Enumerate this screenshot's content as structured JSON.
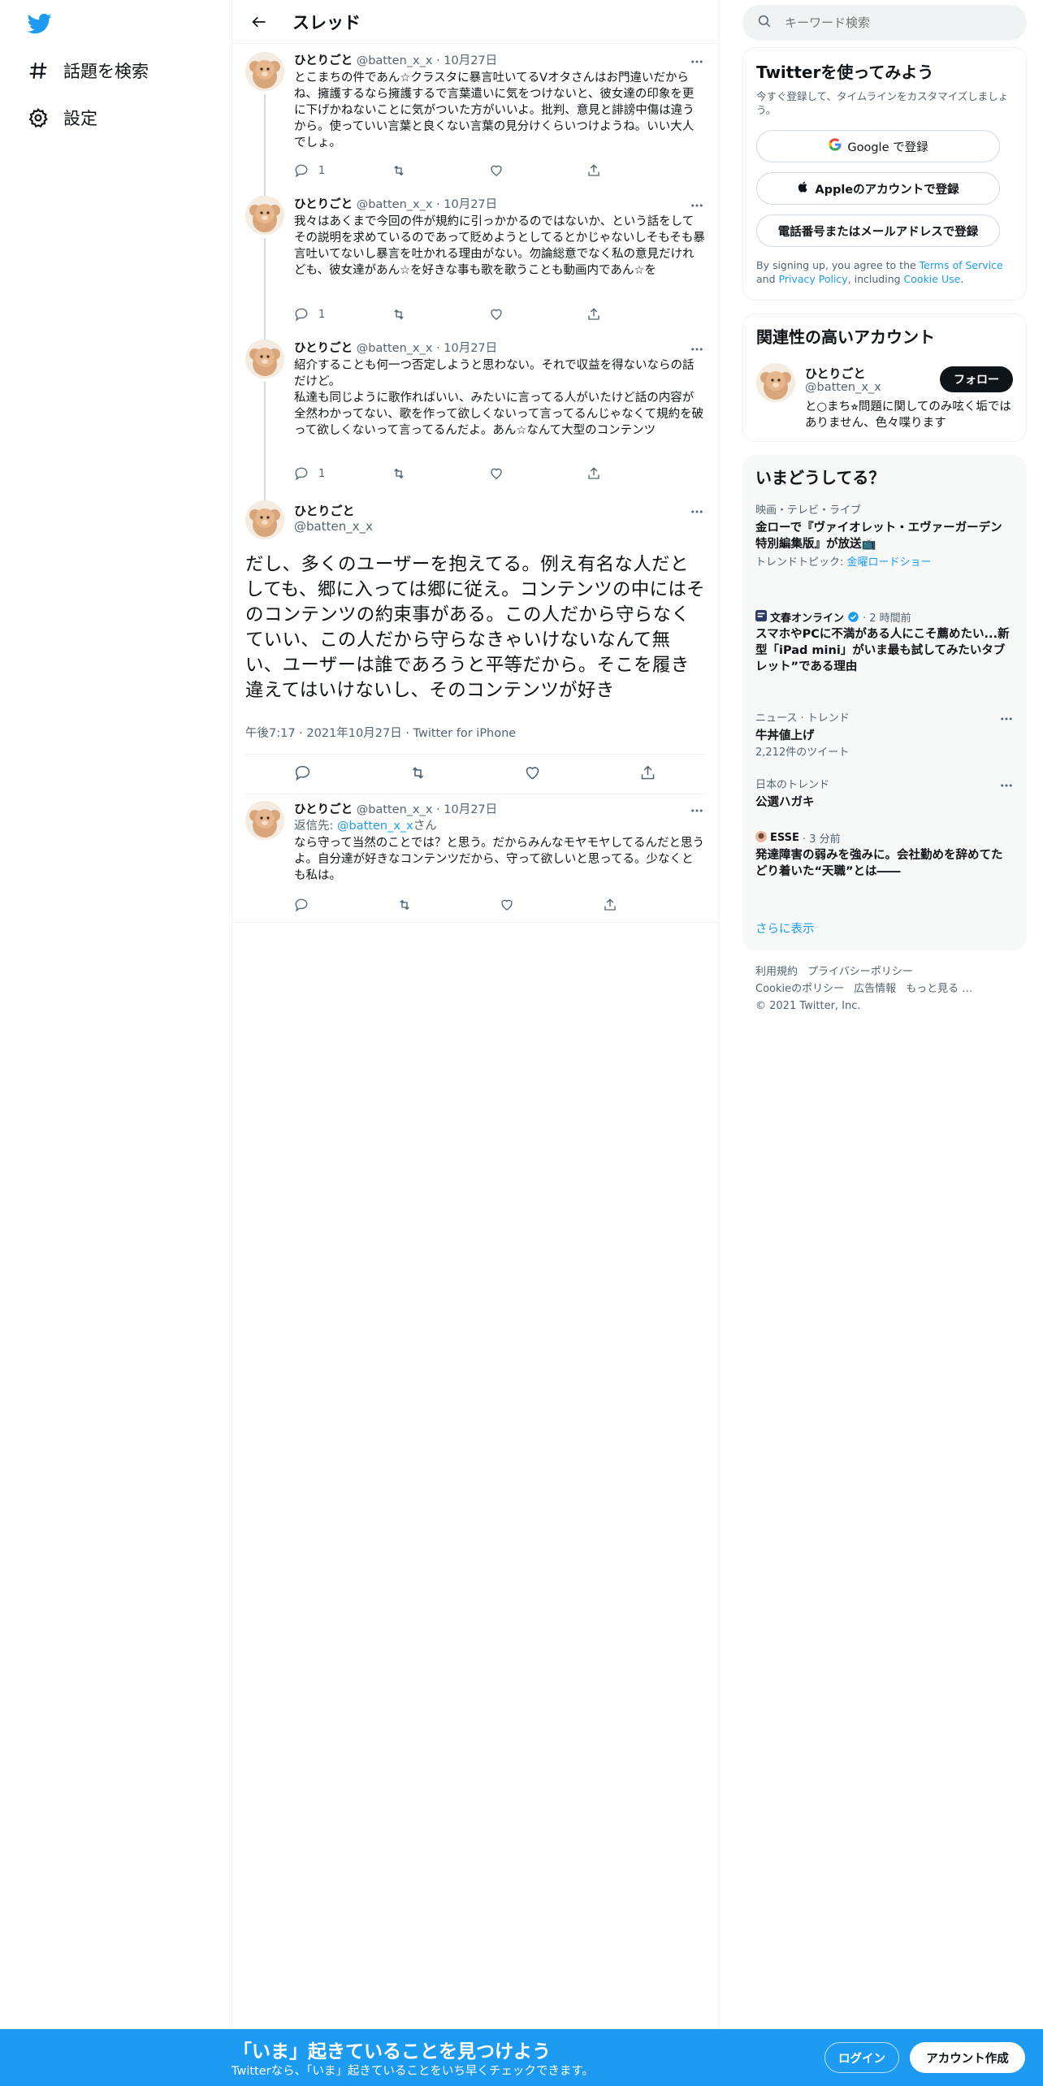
{
  "nav": {
    "explore_label": "話題を検索",
    "settings_label": "設定"
  },
  "header": {
    "title": "スレッド"
  },
  "tweets": [
    {
      "name": "ひとりごと",
      "handle": "@batten_x_x",
      "sep": "·",
      "date": "10月27日",
      "text": "とこまちの件であん☆クラスタに暴言吐いてるVオタさんはお門違いだからね、擁護するなら擁護するで言葉遣いに気をつけないと、彼女達の印象を更に下げかねないことに気がついた方がいいよ。批判、意見と誹謗中傷は違うから。使っていい言葉と良くない言葉の見分けくらいつけようね。いい大人でしょ。",
      "replies": "1"
    },
    {
      "name": "ひとりごと",
      "handle": "@batten_x_x",
      "sep": "·",
      "date": "10月27日",
      "text": "我々はあくまで今回の件が規約に引っかかるのではないか、という話をしてその説明を求めているのであって貶めようとしてるとかじゃないしそもそも暴言吐いてないし暴言を吐かれる理由がない。勿論総意でなく私の意見だけれども、彼女達があん☆を好きな事も歌を歌うことも動画内であん☆を",
      "replies": "1"
    },
    {
      "name": "ひとりごと",
      "handle": "@batten_x_x",
      "sep": "·",
      "date": "10月27日",
      "text": "紹介することも何一つ否定しようと思わない。それで収益を得ないならの話だけど。\n私達も同じように歌作ればいい、みたいに言ってる人がいたけど話の内容が全然わかってない、歌を作って欲しくないって言ってるんじゃなくて規約を破って欲しくないって言ってるんだよ。あん☆なんて大型のコンテンツ",
      "replies": "1"
    }
  ],
  "main_tweet": {
    "name": "ひとりごと",
    "handle": "@batten_x_x",
    "text": "だし、多くのユーザーを抱えてる。例え有名な人だとしても、郷に入っては郷に従え。コンテンツの中にはそのコンテンツの約束事がある。この人だから守らなくていい、この人だから守らなきゃいけないなんて無い、ユーザーは誰であろうと平等だから。そこを履き違えてはいけないし、そのコンテンツが好き",
    "time": "午後7:17",
    "sep": "·",
    "date": "2021年10月27日",
    "source": "Twitter for iPhone"
  },
  "reply_tweet": {
    "name": "ひとりごと",
    "handle": "@batten_x_x",
    "sep": "·",
    "date": "10月27日",
    "reply_prefix": "返信先: ",
    "reply_to": "@batten_x_x",
    "reply_suffix": "さん",
    "text": "なら守って当然のことでは？と思う。だからみんなモヤモヤしてるんだと思うよ。自分達が好きなコンテンツだから、守って欲しいと思ってる。少なくとも私は。"
  },
  "search": {
    "placeholder": "キーワード検索"
  },
  "signup_card": {
    "title": "Twitterを使ってみよう",
    "subtitle": "今すぐ登録して、タイムラインをカスタマイズしましょう。",
    "google_label": "Google で登録",
    "apple_label": "Appleのアカウントで登録",
    "phone_label": "電話番号またはメールアドレスで登録",
    "terms_prefix": "By signing up, you agree to the ",
    "terms_link": "Terms of Service",
    "terms_and": " and ",
    "privacy_link": "Privacy Policy",
    "terms_including": ", including ",
    "cookie_link": "Cookie Use",
    "terms_end": "."
  },
  "related": {
    "title": "関連性の高いアカウント",
    "name": "ひとりごと",
    "handle": "@batten_x_x",
    "bio": "と○まち⭐︎問題に関してのみ呟く垢ではありません、色々喋ります",
    "follow_label": "フォロー"
  },
  "trends": {
    "title": "いまどうしてる？",
    "items": [
      {
        "category": "映画・テレビ・ライブ",
        "title": "金ローで『ヴァイオレット・エヴァーガーデン 特別編集版』が放送📺",
        "sub_prefix": "トレンドトピック: ",
        "sub_link": "金曜ロードショー"
      },
      {
        "source": "文春オンライン",
        "time": "· 2 時間前",
        "title": "スマホやPCに不満がある人にこそ薦めたい...新型「iPad mini」がいま最も試してみたいタブレット”である理由"
      },
      {
        "category": "ニュース · トレンド",
        "title": "牛丼値上げ",
        "sub": "2,212件のツイート"
      },
      {
        "category": "日本のトレンド",
        "title": "公選ハガキ"
      },
      {
        "source": "ESSE",
        "time": "· 3 分前",
        "title": "発達障害の弱みを強みに。会社勤めを辞めてたどり着いた“天職”とは――"
      }
    ],
    "show_more": "さらに表示"
  },
  "footer": {
    "terms": "利用規約",
    "privacy": "プライバシーポリシー",
    "cookie": "Cookieのポリシー",
    "ads": "広告情報",
    "more": "もっと見る …",
    "copyright": "© 2021 Twitter, Inc."
  },
  "banner": {
    "title": "「いま」起きていることを見つけよう",
    "subtitle": "Twitterなら、「いま」起きていることをいち早くチェックできます。",
    "login_label": "ログイン",
    "signup_label": "アカウント作成"
  },
  "colors": {
    "brand": "#1d9bf0",
    "text": "#0f1419",
    "muted": "#536471"
  }
}
